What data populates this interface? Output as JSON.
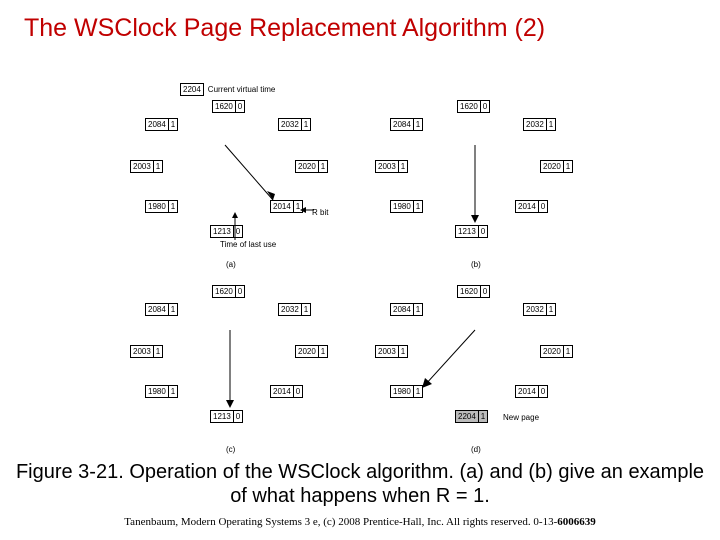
{
  "title": "The WSClock Page Replacement Algorithm (2)",
  "header": {
    "current_virtual_time_value": "2204",
    "current_virtual_time_label": "Current virtual time"
  },
  "annotations": {
    "time_of_last_use": "Time of last use",
    "r_bit": "R bit",
    "new_page": "New page"
  },
  "panel_labels": {
    "a": "(a)",
    "b": "(b)",
    "c": "(c)",
    "d": "(d)"
  },
  "clocks": {
    "a": [
      {
        "t": "1620",
        "r": "0"
      },
      {
        "t": "2032",
        "r": "1"
      },
      {
        "t": "2020",
        "r": "1"
      },
      {
        "t": "2014",
        "r": "1"
      },
      {
        "t": "1213",
        "r": "0"
      },
      {
        "t": "1980",
        "r": "1"
      },
      {
        "t": "2003",
        "r": "1"
      },
      {
        "t": "2084",
        "r": "1"
      }
    ],
    "b": [
      {
        "t": "1620",
        "r": "0"
      },
      {
        "t": "2032",
        "r": "1"
      },
      {
        "t": "2020",
        "r": "1"
      },
      {
        "t": "2014",
        "r": "0"
      },
      {
        "t": "1213",
        "r": "0"
      },
      {
        "t": "1980",
        "r": "1"
      },
      {
        "t": "2003",
        "r": "1"
      },
      {
        "t": "2084",
        "r": "1"
      }
    ],
    "c": [
      {
        "t": "1620",
        "r": "0"
      },
      {
        "t": "2032",
        "r": "1"
      },
      {
        "t": "2020",
        "r": "1"
      },
      {
        "t": "2014",
        "r": "0"
      },
      {
        "t": "1213",
        "r": "0"
      },
      {
        "t": "1980",
        "r": "1"
      },
      {
        "t": "2003",
        "r": "1"
      },
      {
        "t": "2084",
        "r": "1"
      }
    ],
    "d": [
      {
        "t": "1620",
        "r": "0"
      },
      {
        "t": "2032",
        "r": "1"
      },
      {
        "t": "2020",
        "r": "1"
      },
      {
        "t": "2014",
        "r": "0"
      },
      {
        "t": "2204",
        "r": "1"
      },
      {
        "t": "1980",
        "r": "1"
      },
      {
        "t": "2003",
        "r": "1"
      },
      {
        "t": "2084",
        "r": "1"
      }
    ]
  },
  "caption": "Figure 3-21. Operation of the WSClock algorithm. (a) and (b) give an example of what happens when R = 1.",
  "credit_prefix": "Tanenbaum, Modern Operating Systems 3 e, (c) 2008 Prentice-Hall, Inc. All rights reserved. 0-13-",
  "credit_bold": "6006639"
}
